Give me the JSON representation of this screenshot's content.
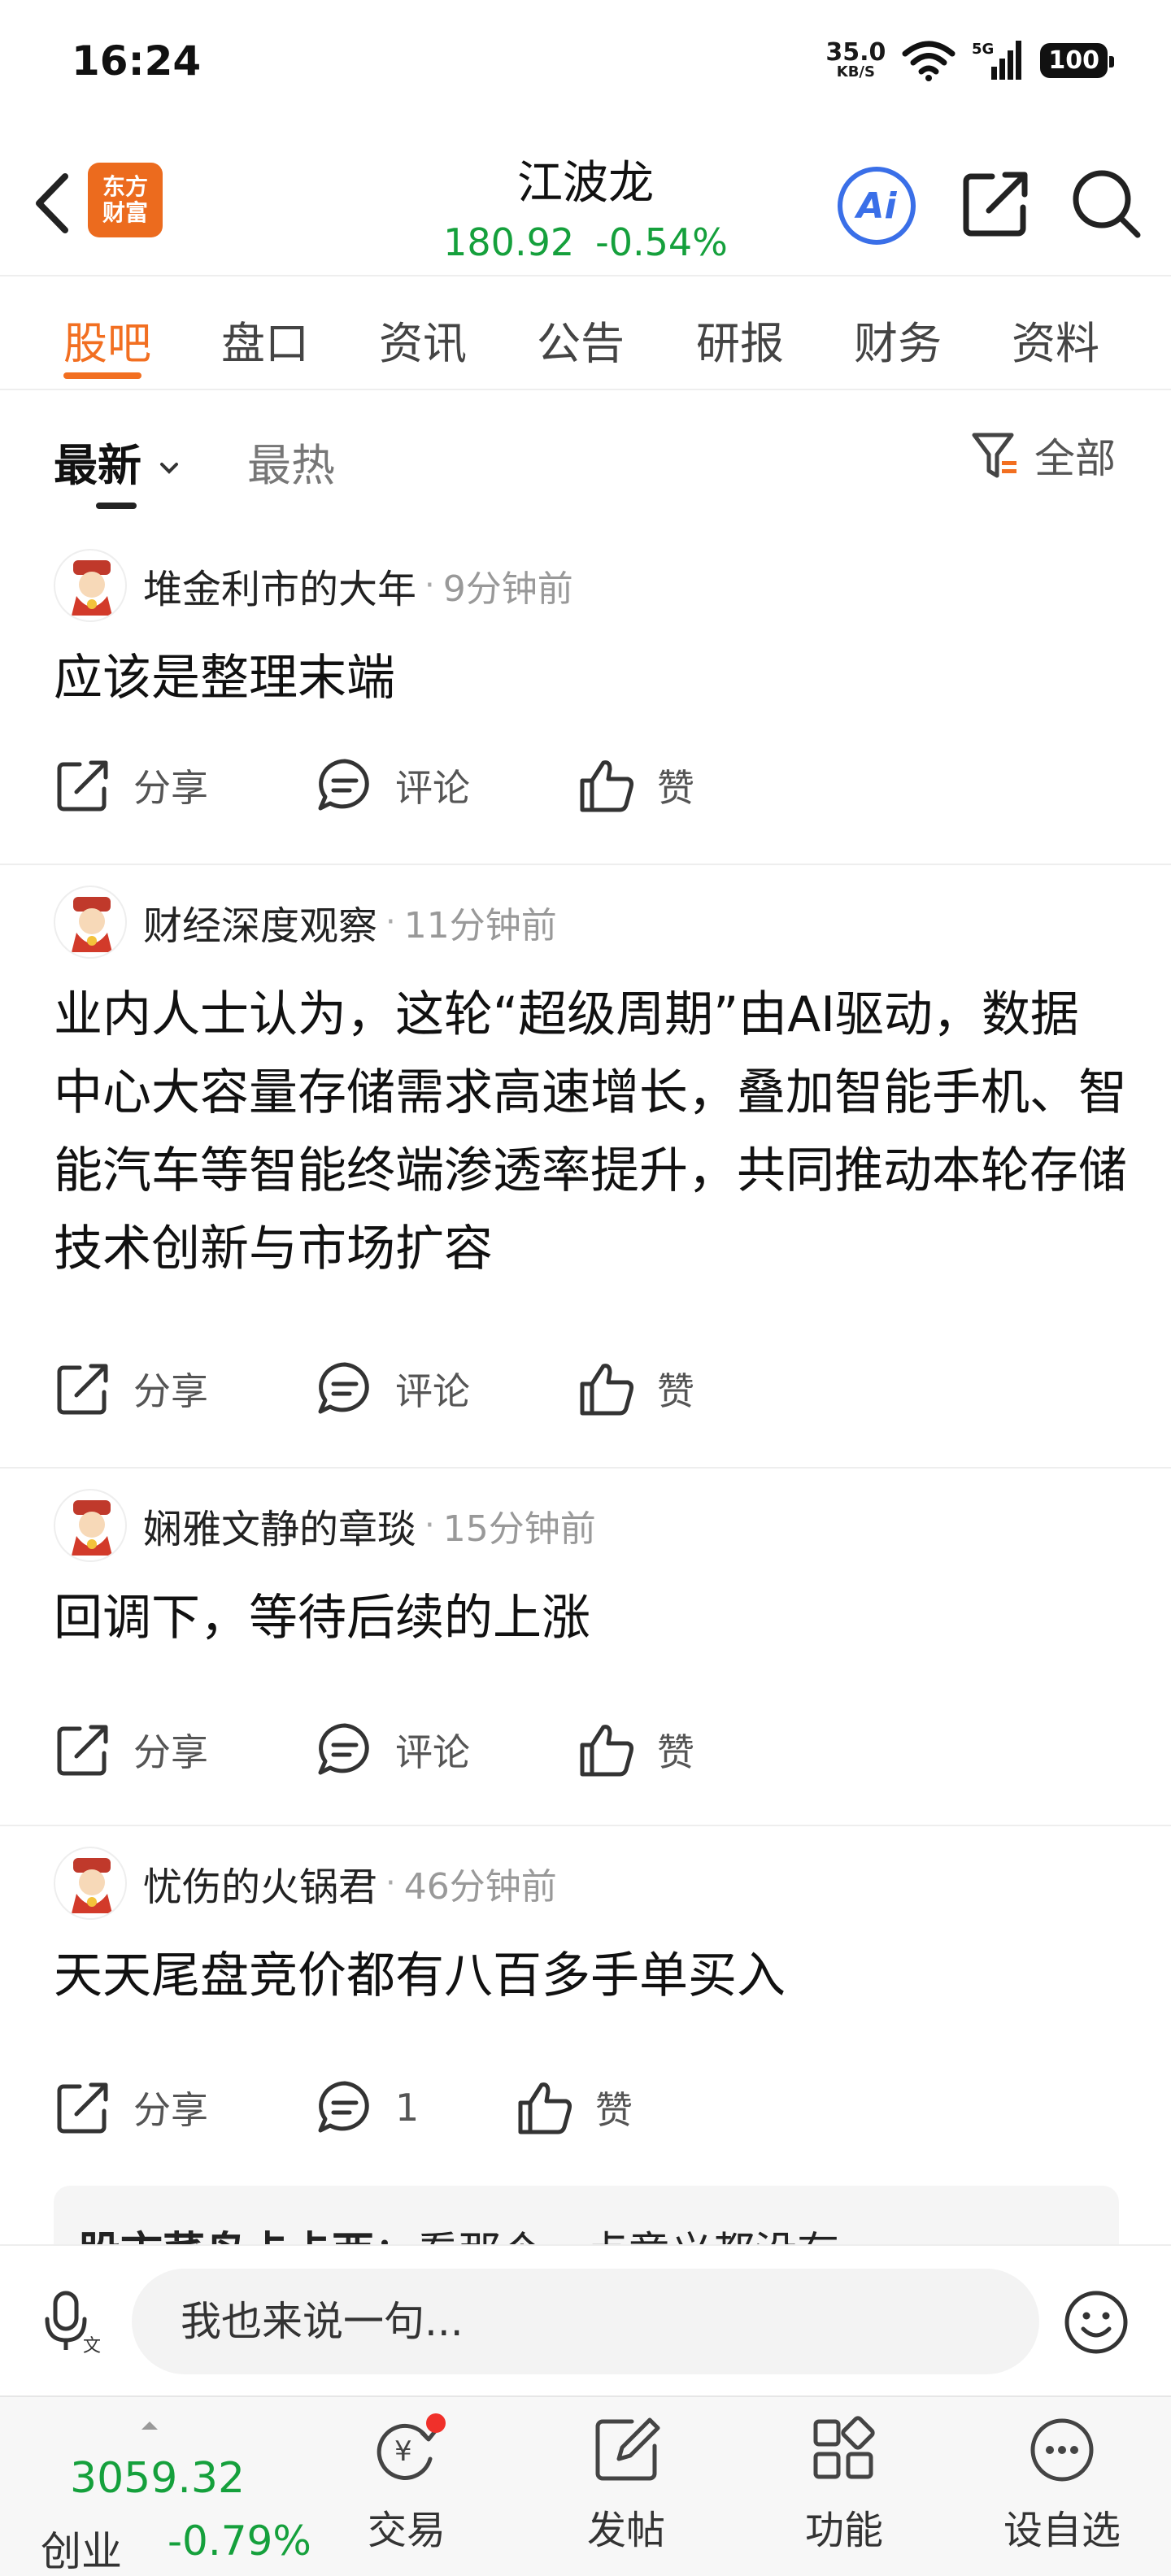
{
  "status_bar": {
    "time": "16:24",
    "net_speed_value": "35.0",
    "net_speed_unit": "KB/S",
    "network": "5G",
    "battery": "100"
  },
  "header": {
    "logo_line1": "东方",
    "logo_line2": "财富",
    "stock_name": "江波龙",
    "price": "180.92",
    "change_pct": "-0.54%",
    "ai_label": "Ai"
  },
  "tabs": [
    "股吧",
    "盘口",
    "资讯",
    "公告",
    "研报",
    "财务",
    "资料"
  ],
  "active_tab": "股吧",
  "filter": {
    "latest": "最新",
    "hot": "最热",
    "all": "全部"
  },
  "posts": [
    {
      "author": "堆金利市的大年",
      "time": "9分钟前",
      "text": "应该是整理末端",
      "share": "分享",
      "comment": "评论",
      "like": "赞"
    },
    {
      "author": "财经深度观察",
      "time": "11分钟前",
      "text": "业内人士认为，这轮“超级周期”由AI驱动，数据中心大容量存储需求高速增长，叠加智能手机、智能汽车等智能终端渗透率提升，共同推动本轮存储技术创新与市场扩容",
      "share": "分享",
      "comment": "评论",
      "like": "赞"
    },
    {
      "author": "娴雅文静的章琰",
      "time": "15分钟前",
      "text": "回调下，等待后续的上涨",
      "share": "分享",
      "comment": "评论",
      "like": "赞"
    },
    {
      "author": "忧伤的火锅君",
      "time": "46分钟前",
      "text": "天天尾盘竞价都有八百多手单买入",
      "share": "分享",
      "comment": "1",
      "like": "赞"
    }
  ],
  "quoted_reply": {
    "author": "股市菜鸟卡卡西",
    "text": "：看那个一点意义都没有"
  },
  "input_bar": {
    "placeholder": "我也来说一句..."
  },
  "bottom_nav": {
    "index_value": "3059.32",
    "index_name": "创业",
    "index_change": "-0.79%",
    "items": [
      "交易",
      "发帖",
      "功能",
      "设自选"
    ]
  },
  "colors": {
    "accent": "#f26f21",
    "down_green": "#15a03c",
    "ai_blue": "#3a6fe8",
    "badge_red": "#f0302a"
  },
  "icons": [
    "back-arrow-icon",
    "ai-icon",
    "share-icon",
    "search-icon",
    "filter-icon",
    "share-icon",
    "comment-icon",
    "thumbs-up-icon",
    "voice-input-icon",
    "emoji-icon",
    "trade-icon",
    "edit-icon",
    "grid-icon",
    "more-icon"
  ]
}
